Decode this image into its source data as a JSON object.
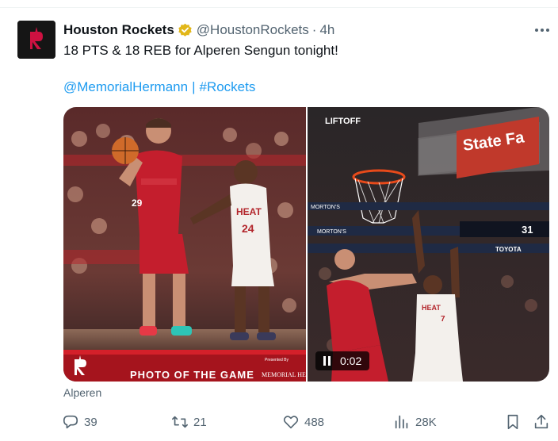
{
  "tweet": {
    "author_name": "Houston Rockets",
    "handle": "@HoustonRockets",
    "separator": "·",
    "time": "4h",
    "text": "18 PTS & 18 REB for Alperen Sengun tonight!",
    "tag_1": "@MemorialHermann",
    "tag_separator": "|",
    "tag_2": "#Rockets",
    "media_caption": "Alperen"
  },
  "media": {
    "photo": {
      "banner_text": "PHOTO OF THE GAME",
      "presented_by": "Presented By",
      "sponsor": "MEMORIAL HERMANN",
      "player_1_number": "29",
      "player_2_number": "24",
      "opponent_jersey": "HEAT"
    },
    "video": {
      "watermark": "LIFTOFF",
      "duration": "0:02",
      "arena_sign": "State Fa",
      "ad_text_1": "MORTON'S",
      "ad_text_2": "TOYOTA",
      "scoreboard_number": "31",
      "defender_number": "7",
      "defender_jersey": "HEAT"
    }
  },
  "actions": {
    "replies": "39",
    "retweets": "21",
    "likes": "488",
    "views": "28K"
  },
  "colors": {
    "link": "#1d9bf0",
    "verified_gold": "#e2b719",
    "rockets_red": "#ce1141",
    "secondary_text": "#536471"
  },
  "icons": {
    "avatar": "rockets-logo",
    "verified": "verified-badge-icon",
    "more": "more-icon",
    "reply": "reply-icon",
    "retweet": "retweet-icon",
    "like": "heart-icon",
    "views": "views-icon",
    "bookmark": "bookmark-icon",
    "share": "share-icon",
    "pause": "pause-icon"
  }
}
